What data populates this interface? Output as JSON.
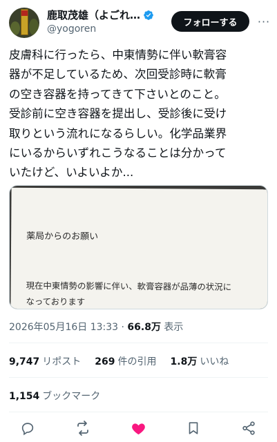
{
  "author": {
    "display_name": "鹿取茂雄（よごれ…",
    "handle": "@yogoren",
    "verified": true
  },
  "header": {
    "follow_label": "フォローする",
    "more_label": "···"
  },
  "tweet": {
    "text": "皮膚科に行ったら、中東情勢に伴い軟膏容\n器が不足しているため、次回受診時に軟膏\nの空き容器を持ってきて下さいとのこと。\n受診前に空き容器を提出し、受診後に受け\n取りという流れになるらしい。化学品業界\nにいるからいずれこうなることは分かって\nいたけど、いよいよか..."
  },
  "photo": {
    "title": "薬局からのお願い",
    "body": "現在中東情勢の影響に伴い、軟膏容器が品薄の状況に\nなっております\nそのため再利用したいと思いますので、次回受診する\n際、軟膏容器をお持ちください(受診前にお持ちいた\nだくと、お待たせする時間が短くなります)\nよろしくお願いいたします"
  },
  "meta": {
    "timestamp": "2026年05月16日 13:33",
    "separator": " · ",
    "views_count": "66.8万",
    "views_label": " 表示"
  },
  "stats": {
    "reposts_count": "9,747",
    "reposts_label": "リポスト",
    "quotes_count": "269",
    "quotes_label": "件の引用",
    "likes_count": "1.8万",
    "likes_label": "いいね",
    "bookmarks_count": "1,154",
    "bookmarks_label": "ブックマーク"
  },
  "icons": {
    "reply": "reply-icon",
    "repost": "repost-icon",
    "like": "heart-icon",
    "bookmark": "bookmark-icon",
    "share": "share-icon"
  },
  "colors": {
    "like_active": "#f91880",
    "verified": "#1d9bf0",
    "follow_bg": "#0f1419"
  }
}
